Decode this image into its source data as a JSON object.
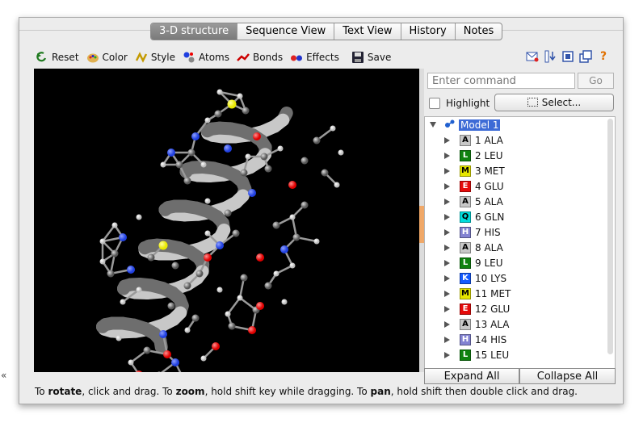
{
  "tabs": [
    {
      "label": "3-D structure",
      "active": true
    },
    {
      "label": "Sequence View",
      "active": false
    },
    {
      "label": "Text View",
      "active": false
    },
    {
      "label": "History",
      "active": false
    },
    {
      "label": "Notes",
      "active": false
    }
  ],
  "toolbar": {
    "reset": "Reset",
    "color": "Color",
    "style": "Style",
    "atoms": "Atoms",
    "bonds": "Bonds",
    "effects": "Effects",
    "save": "Save"
  },
  "right_tools": [
    "mail-icon",
    "download-icon",
    "window-icon",
    "popout-icon",
    "help-icon"
  ],
  "command": {
    "placeholder": "Enter command",
    "go": "Go"
  },
  "highlight_label": "Highlight",
  "select_label": "Select...",
  "tree": {
    "model": "Model 1",
    "residues": [
      {
        "code": "A",
        "label": "1 ALA",
        "color": "#c8c8c8"
      },
      {
        "code": "L",
        "label": "2 LEU",
        "color": "#0f820f"
      },
      {
        "code": "M",
        "label": "3 MET",
        "color": "#e6e600"
      },
      {
        "code": "E",
        "label": "4 GLU",
        "color": "#e60a0a"
      },
      {
        "code": "A",
        "label": "5 ALA",
        "color": "#c8c8c8"
      },
      {
        "code": "Q",
        "label": "6 GLN",
        "color": "#00dcdc"
      },
      {
        "code": "H",
        "label": "7 HIS",
        "color": "#8282d2"
      },
      {
        "code": "A",
        "label": "8 ALA",
        "color": "#c8c8c8"
      },
      {
        "code": "L",
        "label": "9 LEU",
        "color": "#0f820f"
      },
      {
        "code": "K",
        "label": "10 LYS",
        "color": "#145aff"
      },
      {
        "code": "M",
        "label": "11 MET",
        "color": "#e6e600"
      },
      {
        "code": "E",
        "label": "12 GLU",
        "color": "#e60a0a"
      },
      {
        "code": "A",
        "label": "13 ALA",
        "color": "#c8c8c8"
      },
      {
        "code": "H",
        "label": "14 HIS",
        "color": "#8282d2"
      },
      {
        "code": "L",
        "label": "15 LEU",
        "color": "#0f820f"
      }
    ]
  },
  "expand_all": "Expand All",
  "collapse_all": "Collapse All",
  "status": {
    "p1": "To ",
    "b1": "rotate",
    "p2": ", click and drag. To ",
    "b2": "zoom",
    "p3": ", hold shift key while dragging. To ",
    "b3": "pan",
    "p4": ", hold shift then double click and drag."
  },
  "collapse_arrow": "«",
  "colors": {
    "oxygen": "#e00000",
    "nitrogen": "#2040e0",
    "sulfur": "#e8e800",
    "carbon": "#8c8c8c",
    "hydrogen": "#ffffff",
    "ribbon": "#9a9a9a"
  }
}
